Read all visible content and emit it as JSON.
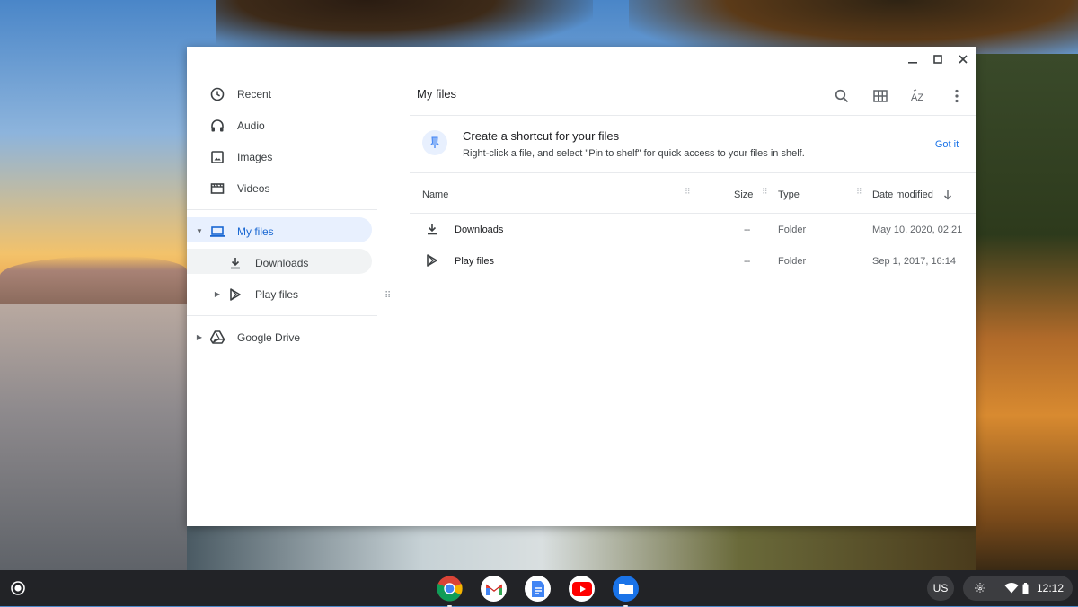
{
  "window": {
    "minimize_icon": "minimize-icon",
    "maximize_icon": "maximize-icon",
    "close_icon": "close-icon"
  },
  "sidebar": {
    "items": [
      {
        "label": "Recent",
        "icon": "clock-icon"
      },
      {
        "label": "Audio",
        "icon": "headphones-icon"
      },
      {
        "label": "Images",
        "icon": "image-icon"
      },
      {
        "label": "Videos",
        "icon": "video-icon"
      }
    ],
    "my_files": {
      "label": "My files",
      "icon": "laptop-icon"
    },
    "downloads": {
      "label": "Downloads",
      "icon": "download-icon"
    },
    "play_files": {
      "label": "Play files",
      "icon": "play-icon"
    },
    "google_drive": {
      "label": "Google Drive",
      "icon": "drive-icon"
    }
  },
  "main": {
    "title": "My files",
    "toolbar": {
      "search": "search-icon",
      "grid": "grid-view-icon",
      "sort": "sort-az-icon",
      "more": "more-vert-icon"
    },
    "banner": {
      "title": "Create a shortcut for your files",
      "text": "Right-click a file, and select \"Pin to shelf\" for quick access to your files in shelf.",
      "button": "Got it"
    },
    "columns": {
      "name": "Name",
      "size": "Size",
      "type": "Type",
      "date": "Date modified"
    },
    "rows": [
      {
        "name": "Downloads",
        "size": "--",
        "type": "Folder",
        "date": "May 10, 2020, 02:21"
      },
      {
        "name": "Play files",
        "size": "--",
        "type": "Folder",
        "date": "Sep 1, 2017, 16:14"
      }
    ]
  },
  "shelf": {
    "apps": [
      "Chrome",
      "Gmail",
      "Docs",
      "YouTube",
      "Files"
    ],
    "ime": "US",
    "time": "12:12"
  },
  "colors": {
    "accent": "#1a73e8",
    "selected_bg": "#e8f0fe",
    "shelf_bg": "#202124"
  }
}
